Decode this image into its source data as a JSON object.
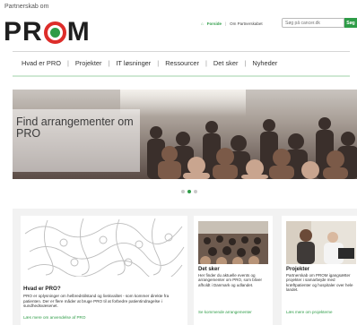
{
  "header": {
    "brand_small": "Partnerskab om",
    "logo_text_left": "PR",
    "logo_text_right": "M",
    "links": {
      "home": "Forside",
      "about": "Om Partnerskabet"
    },
    "search": {
      "placeholder": "Søg på cancer.dk",
      "button": "Søg"
    }
  },
  "nav": {
    "items": [
      "Hvad er PRO",
      "Projekter",
      "IT løsninger",
      "Ressourcer",
      "Det sker",
      "Nyheder"
    ]
  },
  "hero": {
    "title": "Find arrangementer om PRO",
    "slides": 3,
    "active_slide": 2
  },
  "cards": {
    "pro": {
      "title": "Hvad er PRO?",
      "text": "PRO er oplysninger om helbredstilstand og livskvalitet - som kommer direkte fra patienten. Der er flere måder at bruge PRO til at forbedre patientindragelse i sundhedsvæsenet.",
      "link": "Læs mere om anvendelse af PRO"
    },
    "det_sker": {
      "title": "Det sker",
      "text": "Her finder du aktuelle events og arrangementer om PRO, som bliver afholdt i Danmark og udlandet.",
      "link": "Se kommende arrangementer"
    },
    "projekter": {
      "title": "Projekter",
      "text": "Partnerskab om PROM igangsætter projekter i samarbejde med kræftpatienter og hospitaler over hele landet.",
      "link": "Læs mere om projekterne"
    }
  },
  "colors": {
    "accent_green": "#2e9c47",
    "logo_red": "#dd2d2a"
  }
}
